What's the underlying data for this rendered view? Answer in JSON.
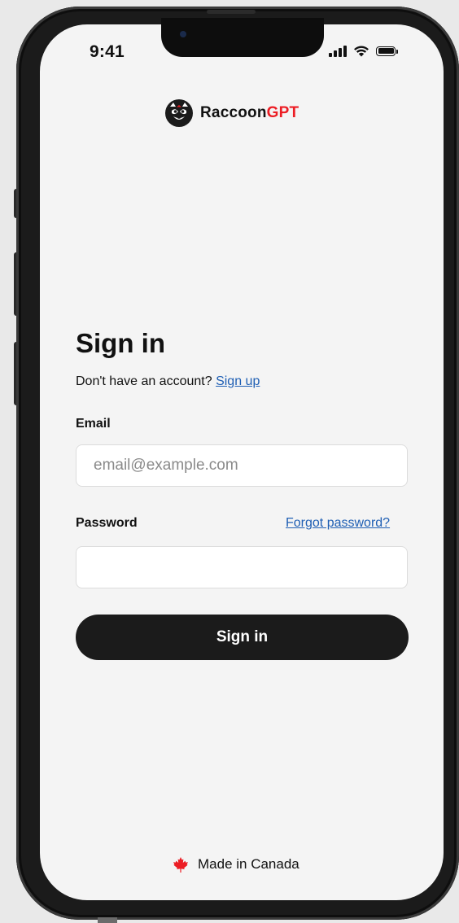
{
  "status_bar": {
    "time": "9:41"
  },
  "brand": {
    "logo_icon": "raccoon-icon",
    "name_main": "Raccoon",
    "name_accent": "GPT",
    "accent_color": "#ec1d24"
  },
  "signin": {
    "title": "Sign in",
    "no_account_text": "Don't have an account?",
    "signup_link": "Sign up",
    "email_label": "Email",
    "email_placeholder": "email@example.com",
    "email_value": "",
    "password_label": "Password",
    "forgot_link": "Forgot password?",
    "password_value": "",
    "submit_label": "Sign in"
  },
  "footer": {
    "icon": "maple-leaf-icon",
    "text": "Made in Canada"
  },
  "colors": {
    "link": "#1f5fb4",
    "button_bg": "#1b1b1b",
    "screen_bg": "#f4f4f4"
  }
}
